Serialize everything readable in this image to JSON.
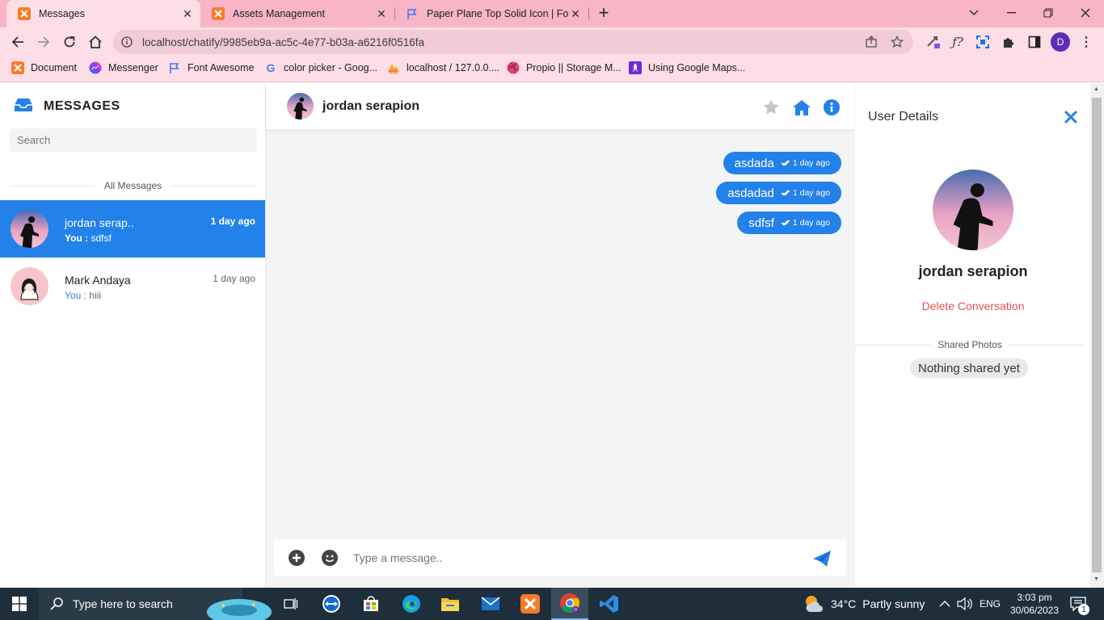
{
  "browser": {
    "tabs": [
      {
        "title": "Messages",
        "icon": "xampp-icon",
        "active": true
      },
      {
        "title": "Assets Management",
        "icon": "xampp-icon",
        "active": false
      },
      {
        "title": "Paper Plane Top Solid Icon | Font",
        "icon": "flag-icon",
        "active": false
      }
    ],
    "url": "localhost/chatify/9985eb9a-ac5c-4e77-b03a-a6216f0516fa",
    "profile_initial": "D",
    "bookmarks": [
      {
        "label": "Document",
        "icon": "xampp-icon"
      },
      {
        "label": "Messenger",
        "icon": "messenger-icon"
      },
      {
        "label": "Font Awesome",
        "icon": "flag-icon"
      },
      {
        "label": "color picker - Goog...",
        "icon": "google-icon"
      },
      {
        "label": "localhost / 127.0.0....",
        "icon": "phpmyadmin-icon"
      },
      {
        "label": "Propio || Storage M...",
        "icon": "dribbble-icon"
      },
      {
        "label": "Using Google Maps...",
        "icon": "rocket-icon"
      }
    ]
  },
  "sidebar": {
    "brand": "MESSAGES",
    "search_placeholder": "Search",
    "section_label": "All Messages",
    "contacts": [
      {
        "name": "jordan serap..",
        "you_prefix": "You :",
        "last": "sdfsf",
        "time": "1 day ago",
        "active": true
      },
      {
        "name": "Mark Andaya",
        "you_prefix": "You :",
        "last": "hiii",
        "time": "1 day ago",
        "active": false
      }
    ]
  },
  "chat": {
    "contact_name": "jordan serapion",
    "messages": [
      {
        "text": "asdada",
        "time": "1 day ago"
      },
      {
        "text": "asdadad",
        "time": "1 day ago"
      },
      {
        "text": "sdfsf",
        "time": "1 day ago"
      }
    ],
    "input_placeholder": "Type a message.."
  },
  "details": {
    "title": "User Details",
    "name": "jordan serapion",
    "delete_label": "Delete Conversation",
    "shared_label": "Shared Photos",
    "shared_empty": "Nothing shared yet"
  },
  "taskbar": {
    "search_placeholder": "Type here to search",
    "weather_temp": "34°C",
    "weather_desc": "Partly sunny",
    "language": "ENG",
    "time": "3:03 pm",
    "date": "30/06/2023",
    "notifications": "1"
  },
  "colors": {
    "accent": "#2381ea",
    "danger": "#e4504e",
    "tabbar": "#f7b5c7",
    "toolbar": "#fddde6"
  }
}
